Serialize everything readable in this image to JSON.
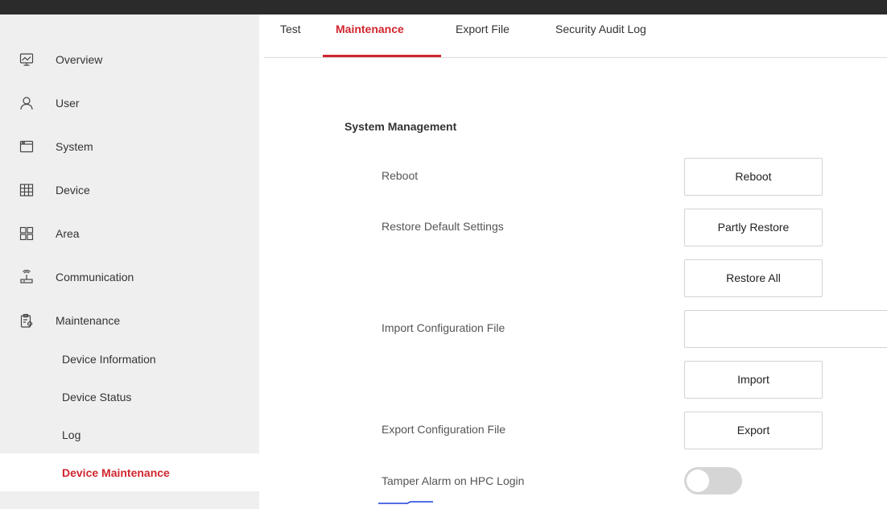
{
  "sidebar": {
    "items": [
      {
        "label": "Overview",
        "icon": "overview-monitor-icon"
      },
      {
        "label": "User",
        "icon": "user-icon"
      },
      {
        "label": "System",
        "icon": "system-window-icon"
      },
      {
        "label": "Device",
        "icon": "device-grid-icon"
      },
      {
        "label": "Area",
        "icon": "area-squares-icon"
      },
      {
        "label": "Communication",
        "icon": "communication-antenna-icon"
      },
      {
        "label": "Maintenance",
        "icon": "maintenance-clipboard-icon"
      }
    ],
    "subitems": [
      {
        "label": "Device Information"
      },
      {
        "label": "Device Status"
      },
      {
        "label": "Log"
      },
      {
        "label": "Device Maintenance",
        "active": true
      }
    ]
  },
  "tabs": [
    {
      "label": "Test"
    },
    {
      "label": "Maintenance",
      "active": true
    },
    {
      "label": "Export File"
    },
    {
      "label": "Security Audit Log"
    }
  ],
  "main": {
    "section_title": "System Management",
    "reboot": {
      "label": "Reboot",
      "button": "Reboot"
    },
    "restore": {
      "label": "Restore Default Settings",
      "partly_button": "Partly Restore",
      "all_button": "Restore All"
    },
    "import_config": {
      "label": "Import Configuration File",
      "file_value": "",
      "button": "Import"
    },
    "export_config": {
      "label": "Export Configuration File",
      "button": "Export"
    },
    "tamper_alarm": {
      "label": "Tamper Alarm on HPC Login",
      "enabled": false
    }
  },
  "colors": {
    "accent": "#d0262f",
    "sidebar_bg": "#efefef",
    "topbar": "#2b2b2b",
    "toggle_off": "#d5d5d5"
  }
}
